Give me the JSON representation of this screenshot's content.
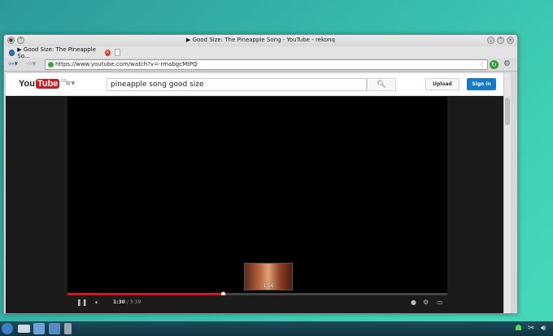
{
  "window": {
    "title": "▶ Good Size: The Pineapple Song - YouTube - rekonq"
  },
  "tab": {
    "label": "▶ Good Size: The Pineapple So..."
  },
  "navbar": {
    "url": "https://www.youtube.com/watch?v=-rmabgcMtPQ"
  },
  "youtube": {
    "logo_you": "You",
    "logo_tube": "Tube",
    "region": "GB",
    "search_value": "pineapple song good size",
    "upload_label": "Upload",
    "signin_label": "Sign in"
  },
  "player": {
    "preview_time": "1:56",
    "current_time": "1:30",
    "duration": "/ 3:39",
    "progress_fraction": 0.41
  },
  "colors": {
    "youtube_red": "#cc181e",
    "signin_blue": "#167ac6",
    "reload_green": "#2f9c3a"
  }
}
